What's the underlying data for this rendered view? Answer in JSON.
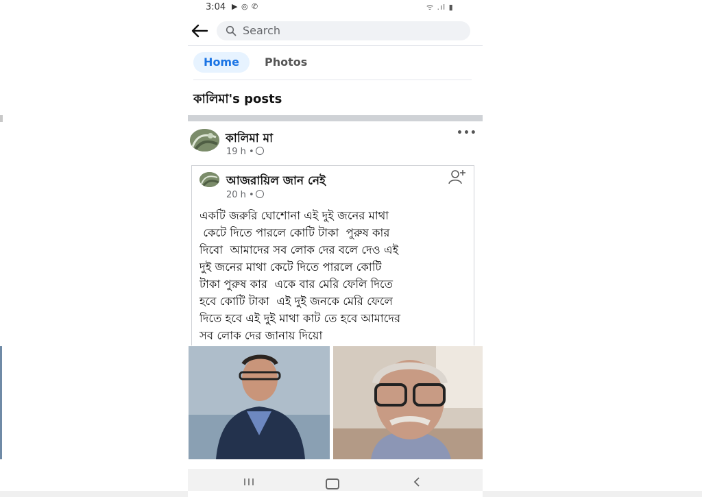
{
  "status_bar": {
    "time": "3:04"
  },
  "search": {
    "placeholder": "Search"
  },
  "tabs": [
    {
      "label": "Home",
      "active": true
    },
    {
      "label": "Photos",
      "active": false
    }
  ],
  "page": {
    "posts_title": "কালিমা's posts"
  },
  "post": {
    "author": "কালিমা মা",
    "time": "19 h •",
    "shared": {
      "author": "আজরায়িল জান নেই",
      "time": "20 h •",
      "body_lines": [
        "একটি জরুরি ঘোশোনা এই দুই জনের মাথা",
        " কেটে দিতে পারলে কোটি টাকা  পুরুষ কার",
        "দিবো  আমাদের সব লোক দের বলে দেও এই",
        "দুই জনের মাথা কেটে দিতে পারলে কোটি",
        "টাকা পুরুষ কার  একে বার মেরি ফেলি দিতে",
        "হবে কোটি টাকা  এই দুই জনকে মেরি ফেলে",
        "দিতে হবে এই দুই মাথা কাট তে হবে আমাদের",
        "সব লোক দের জানায় দিয়ো"
      ]
    }
  },
  "icons": {
    "back": "arrow-left-icon",
    "search": "search-icon",
    "more": "more-horizontal-icon",
    "add_friend": "add-friend-icon",
    "globe": "globe-icon"
  },
  "colors": {
    "accent": "#1b74e4",
    "tab_active_bg": "#e7f3ff",
    "search_bg": "#f0f2f5"
  }
}
